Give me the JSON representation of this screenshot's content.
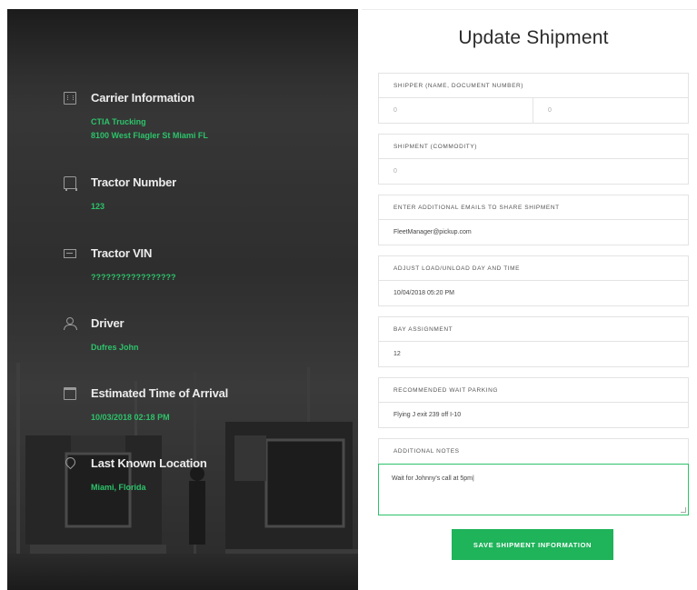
{
  "left_panel": {
    "items": [
      {
        "icon": "building-icon",
        "title": "Carrier Information",
        "lines": [
          "CTIA Trucking",
          "8100 West Flagler St Miami FL"
        ]
      },
      {
        "icon": "truck-icon",
        "title": "Tractor Number",
        "lines": [
          "123"
        ]
      },
      {
        "icon": "id-card-icon",
        "title": "Tractor VIN",
        "lines": [
          "?????????????????"
        ]
      },
      {
        "icon": "user-icon",
        "title": "Driver",
        "lines": [
          "Dufres John"
        ]
      },
      {
        "icon": "calendar-icon",
        "title": "Estimated Time of Arrival",
        "lines": [
          "10/03/2018 02:18 PM"
        ]
      },
      {
        "icon": "map-pin-icon",
        "title": "Last Known Location",
        "lines": [
          "Miami, Florida"
        ]
      }
    ]
  },
  "form": {
    "title": "Update Shipment",
    "shipper": {
      "label": "SHIPPER (NAME, DOCUMENT NUMBER)",
      "name_placeholder": "0",
      "doc_placeholder": "0"
    },
    "shipment": {
      "label": "SHIPMENT (COMMODITY)",
      "placeholder": "0"
    },
    "emails": {
      "label": "ENTER ADDITIONAL EMAILS TO SHARE SHIPMENT",
      "value": "FleetManager@pickup.com"
    },
    "load_time": {
      "label": "ADJUST LOAD/UNLOAD DAY AND TIME",
      "value": "10/04/2018 05:20 PM"
    },
    "bay": {
      "label": "BAY ASSIGNMENT",
      "value": "12"
    },
    "parking": {
      "label": "RECOMMENDED WAIT PARKING",
      "value": "Flying J exit 239 off I-10"
    },
    "notes": {
      "label": "ADDITIONAL NOTES",
      "value": "Wait for Johnny's call at 5pm|"
    },
    "save_label": "SAVE SHIPMENT INFORMATION"
  },
  "colors": {
    "accent": "#1fb35a",
    "panel_bg": "#333333",
    "value_text": "#2cc36a"
  }
}
